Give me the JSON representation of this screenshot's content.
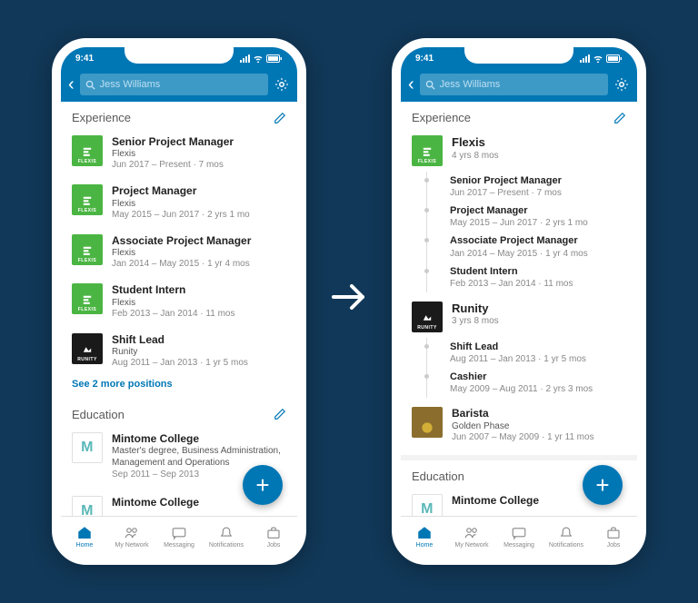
{
  "status": {
    "time": "9:41",
    "wifi": true,
    "battery": true
  },
  "search": {
    "value": "Jess Williams"
  },
  "sections": {
    "experience": "Experience",
    "education": "Education",
    "see_more": "See 2 more positions"
  },
  "left": {
    "jobs": [
      {
        "title": "Senior Project Manager",
        "company": "Flexis",
        "dates": "Jun 2017 – Present · 7 mos",
        "logo": "flexis"
      },
      {
        "title": "Project Manager",
        "company": "Flexis",
        "dates": "May 2015 – Jun 2017 · 2 yrs 1 mo",
        "logo": "flexis"
      },
      {
        "title": "Associate Project Manager",
        "company": "Flexis",
        "dates": "Jan 2014 – May 2015 · 1 yr 4 mos",
        "logo": "flexis"
      },
      {
        "title": "Student Intern",
        "company": "Flexis",
        "dates": "Feb 2013 – Jan 2014 · 11 mos",
        "logo": "flexis"
      },
      {
        "title": "Shift Lead",
        "company": "Runity",
        "dates": "Aug 2011 – Jan 2013 · 1 yr 5 mos",
        "logo": "runity"
      }
    ],
    "education": [
      {
        "school": "Mintome College",
        "degree": "Master's degree, Business Administration, Management and Operations",
        "dates": "Sep 2011 – Sep 2013"
      },
      {
        "school": "Mintome College",
        "degree": "",
        "dates": ""
      }
    ]
  },
  "right": {
    "groups": [
      {
        "company": "Flexis",
        "duration": "4 yrs 8 mos",
        "logo": "flexis",
        "roles": [
          {
            "title": "Senior Project Manager",
            "dates": "Jun 2017 – Present · 7 mos"
          },
          {
            "title": "Project Manager",
            "dates": "May 2015 – Jun 2017 · 2 yrs 1 mo"
          },
          {
            "title": "Associate Project Manager",
            "dates": "Jan 2014 – May 2015 · 1 yr 4 mos"
          },
          {
            "title": "Student Intern",
            "dates": "Feb 2013 – Jan 2014 · 11 mos"
          }
        ]
      },
      {
        "company": "Runity",
        "duration": "3 yrs 8 mos",
        "logo": "runity",
        "roles": [
          {
            "title": "Shift Lead",
            "dates": "Aug 2011 – Jan 2013 · 1 yr 5 mos"
          },
          {
            "title": "Cashier",
            "dates": "May 2009 – Aug 2011 · 2 yrs 3 mos"
          }
        ]
      }
    ],
    "single": {
      "title": "Barista",
      "company": "Golden Phase",
      "dates": "Jun 2007 – May 2009 · 1 yr 11 mos",
      "logo": "golden"
    },
    "education": [
      {
        "school": "Mintome College"
      }
    ]
  },
  "nav": {
    "items": [
      {
        "label": "Home",
        "icon": "home",
        "active": true
      },
      {
        "label": "My Network",
        "icon": "people",
        "active": false
      },
      {
        "label": "Messaging",
        "icon": "message",
        "active": false
      },
      {
        "label": "Notifications",
        "icon": "bell",
        "active": false
      },
      {
        "label": "Jobs",
        "icon": "briefcase",
        "active": false
      }
    ]
  }
}
